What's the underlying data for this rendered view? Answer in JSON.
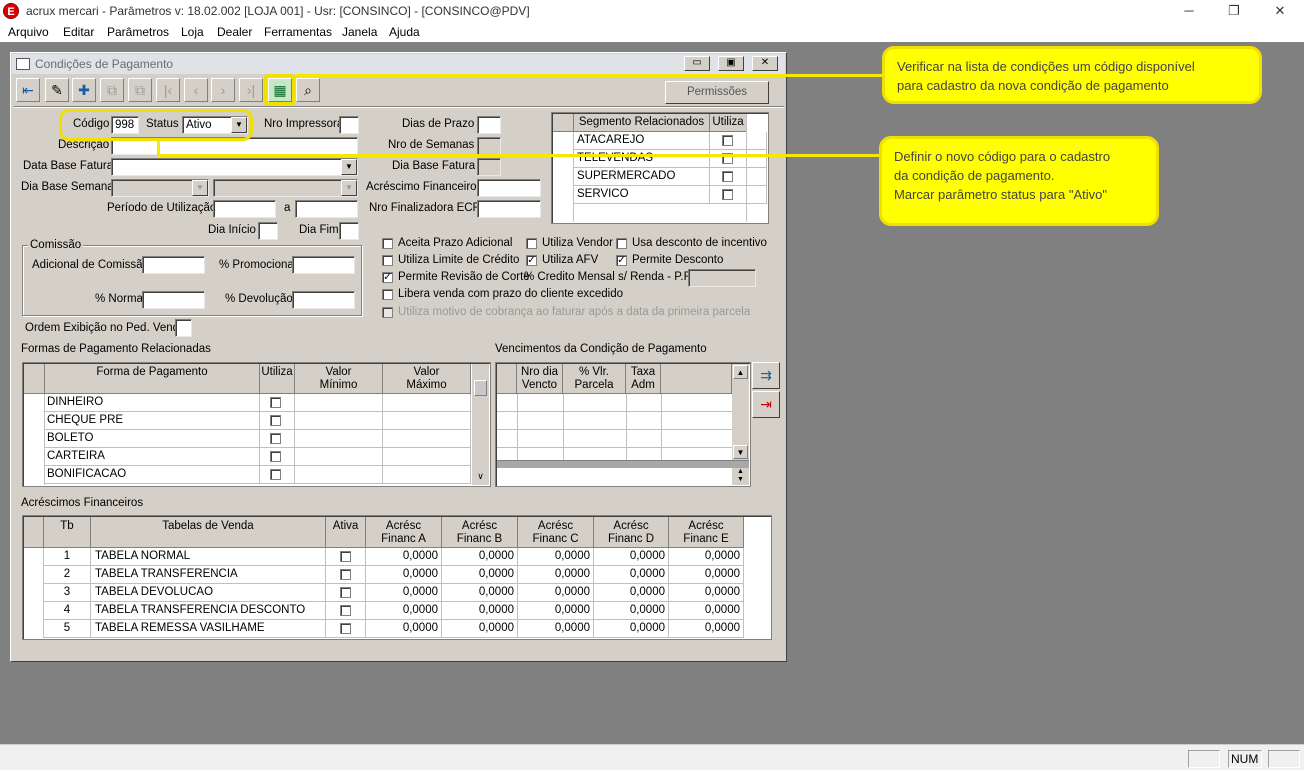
{
  "app": {
    "title": "acrux mercari - Parâmetros  v: 18.02.002  [LOJA 001] - Usr: [CONSINCO] - [CONSINCO@PDV]",
    "logo": "E",
    "minimize": "─",
    "restore": "❐",
    "close": "✕"
  },
  "menu": [
    "Arquivo",
    "Editar",
    "Parâmetros",
    "Loja",
    "Dealer",
    "Ferramentas",
    "Janela",
    "Ajuda"
  ],
  "status": {
    "num": "NUM"
  },
  "child": {
    "title": "Condições de Pagamento",
    "permissions_label": "Permissões"
  },
  "form": {
    "codigo_label": "Código",
    "codigo_value": "998",
    "status_label": "Status",
    "status_value": "Ativo",
    "nro_impressora_label": "Nro Impressora",
    "dias_prazo_label": "Dias de Prazo",
    "descricao_label": "Descrição",
    "nro_semanas_label": "Nro de Semanas",
    "data_base_fatura_label": "Data Base Fatura",
    "dia_base_fatura_label": "Dia Base Fatura",
    "dia_base_semana_label": "Dia Base Semana",
    "acrescimo_financeiro_label": "Acréscimo Financeiro",
    "periodo_utilizacao_label": "Período de Utilização",
    "periodo_sep": "a",
    "nro_finalizadora_label": "Nro Finalizadora ECF",
    "dia_inicio_label": "Dia Início",
    "dia_fim_label": "Dia Fim",
    "comissao_group": "Comissão",
    "adicional_comissao_label": "Adicional de Comissão",
    "promocional_label": "% Promocional",
    "normal_label": "% Normal",
    "devolucao_label": "% Devolução",
    "ordem_exibicao_label": "Ordem Exibição no Ped. Venda"
  },
  "segmentos": {
    "header_segmento": "Segmento Relacionados",
    "header_utiliza": "Utiliza",
    "rows": [
      "ATACAREJO",
      "TELEVENDAS",
      "SUPERMERCADO",
      "SERVICO"
    ]
  },
  "checks": {
    "aceita_prazo": "Aceita Prazo Adicional",
    "utiliza_vendor": "Utiliza Vendor",
    "usa_desconto": "Usa desconto de incentivo",
    "utiliza_limite": "Utiliza Limite de Crédito",
    "utiliza_afv": "Utiliza AFV",
    "permite_desconto": "Permite Desconto",
    "permite_revisao": "Permite Revisão de Corte",
    "credito_mensal": "% Credito Mensal s/ Renda - P.F.",
    "libera_venda": "Libera venda com prazo do cliente excedido",
    "utiliza_motivo": "Utiliza motivo de cobrança ao faturar após a data da primeira parcela"
  },
  "formas": {
    "title": "Formas de Pagamento Relacionadas",
    "headers": {
      "forma": "Forma de Pagamento",
      "utiliza": "Utiliza",
      "vmin": "Valor\nMínimo",
      "vmax": "Valor\nMáximo"
    },
    "rows": [
      "DINHEIRO",
      "CHEQUE PRE",
      "BOLETO",
      "CARTEIRA",
      "BONIFICACAO"
    ]
  },
  "vencimentos": {
    "title": "Vencimentos da Condição de Pagamento",
    "headers": {
      "nro": "Nro dia\nVencto",
      "vlr": "% Vlr.\nParcela",
      "taxa": "Taxa\nAdm"
    }
  },
  "acrescimos": {
    "title": "Acréscimos Financeiros",
    "headers": {
      "tb": "Tb",
      "tabela": "Tabelas de Venda",
      "ativa": "Ativa",
      "a": "Acrésc\nFinanc A",
      "b": "Acrésc\nFinanc B",
      "c": "Acrésc\nFinanc C",
      "d": "Acrésc\nFinanc D",
      "e": "Acrésc\nFinanc E"
    },
    "rows": [
      {
        "tb": "1",
        "tabela": "TABELA NORMAL",
        "a": "0,0000",
        "b": "0,0000",
        "c": "0,0000",
        "d": "0,0000",
        "e": "0,0000"
      },
      {
        "tb": "2",
        "tabela": "TABELA TRANSFERENCIA",
        "a": "0,0000",
        "b": "0,0000",
        "c": "0,0000",
        "d": "0,0000",
        "e": "0,0000"
      },
      {
        "tb": "3",
        "tabela": "TABELA DEVOLUCAO",
        "a": "0,0000",
        "b": "0,0000",
        "c": "0,0000",
        "d": "0,0000",
        "e": "0,0000"
      },
      {
        "tb": "4",
        "tabela": "TABELA TRANSFERENCIA DESCONTO",
        "a": "0,0000",
        "b": "0,0000",
        "c": "0,0000",
        "d": "0,0000",
        "e": "0,0000"
      },
      {
        "tb": "5",
        "tabela": "TABELA REMESSA VASILHAME",
        "a": "0,0000",
        "b": "0,0000",
        "c": "0,0000",
        "d": "0,0000",
        "e": "0,0000"
      }
    ]
  },
  "annotations": {
    "callout1_line1": "Verificar na lista de condições um código disponível",
    "callout1_line2": "para cadastro da nova condição de pagamento",
    "callout2_line1": "Definir o novo código para o cadastro",
    "callout2_line2": "da condição de pagamento.",
    "callout2_line3": "Marcar parâmetro status para \"Ativo\""
  },
  "colors": {
    "highlight": "#ffff00",
    "window_bg": "#d4d0c8",
    "mdi_bg": "#808080"
  },
  "icons": [
    "exit-icon",
    "eraser-icon",
    "add-icon",
    "copy-icon",
    "first-icon",
    "prev-icon",
    "next-icon",
    "last-icon",
    "list-icon",
    "binoculars-icon"
  ]
}
